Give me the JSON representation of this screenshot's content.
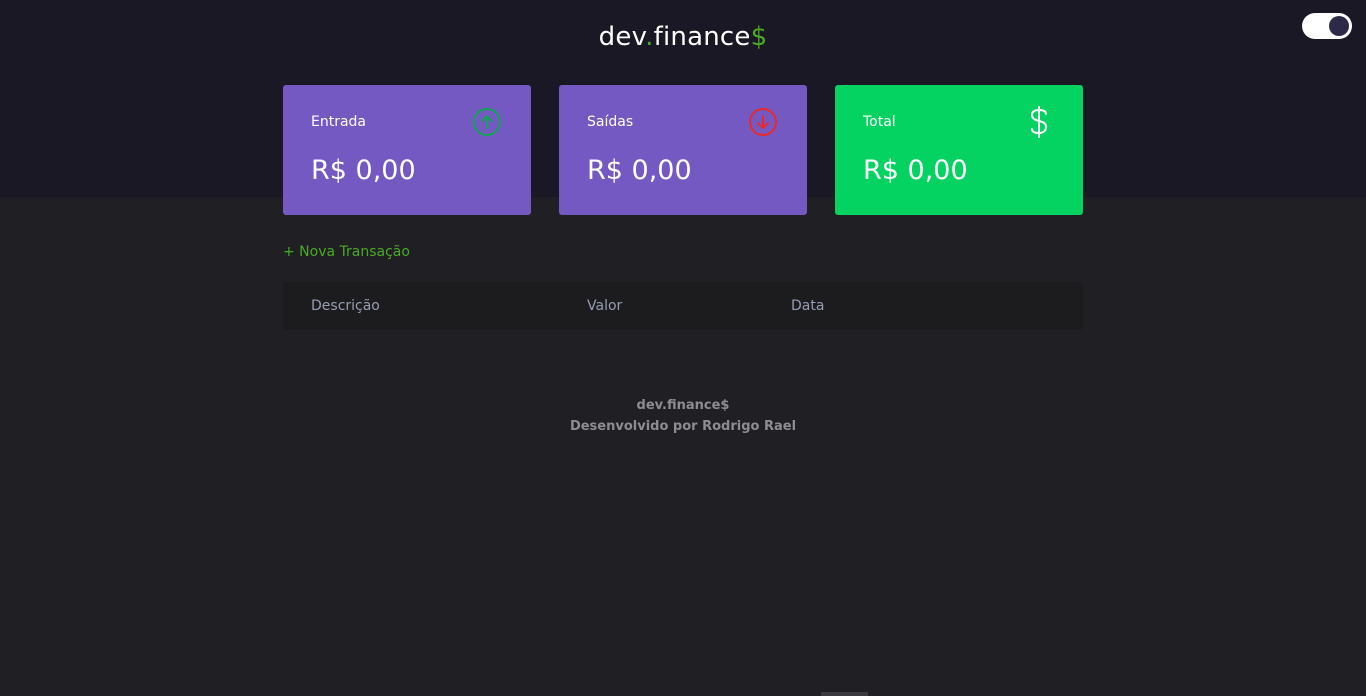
{
  "header": {
    "logo": {
      "part1": "dev",
      "dot": ".",
      "part2": "finance",
      "dollar": "$"
    }
  },
  "cards": [
    {
      "label": "Entrada",
      "amount": "R$ 0,00",
      "icon": "arrow-up-circle-icon",
      "icon_color": "#12a454"
    },
    {
      "label": "Saídas",
      "amount": "R$ 0,00",
      "icon": "arrow-down-circle-icon",
      "icon_color": "#e92929"
    },
    {
      "label": "Total",
      "amount": "R$ 0,00",
      "icon": "dollar-sign-icon",
      "icon_color": "#ffffff"
    }
  ],
  "actions": {
    "new_transaction": "+ Nova Transação"
  },
  "table": {
    "columns": [
      "Descrição",
      "Valor",
      "Data"
    ]
  },
  "footer": {
    "line1": "dev.finance$",
    "line2": "Desenvolvido por Rodrigo Rael"
  },
  "colors": {
    "header_bg": "#1a1824",
    "body_bg": "#202024",
    "card_purple": "#7459c2",
    "card_green": "#04d361",
    "accent_green": "#49aa26"
  }
}
